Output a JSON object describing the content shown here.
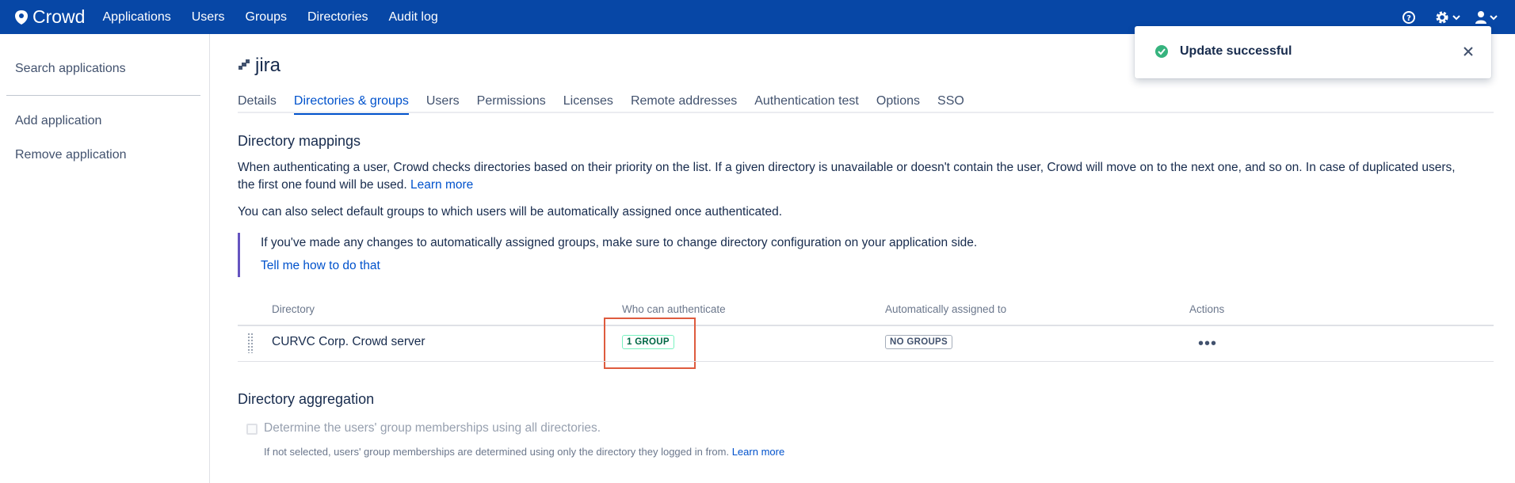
{
  "app": {
    "name": "Crowd"
  },
  "topnav": {
    "items": [
      "Applications",
      "Users",
      "Groups",
      "Directories",
      "Audit log"
    ]
  },
  "topbar_icons": [
    "help-icon",
    "settings-icon",
    "user-icon"
  ],
  "sidebar": {
    "items": [
      "Search applications",
      "Add application",
      "Remove application"
    ]
  },
  "page": {
    "title": "jira"
  },
  "tabs": [
    "Details",
    "Directories & groups",
    "Users",
    "Permissions",
    "Licenses",
    "Remote addresses",
    "Authentication test",
    "Options",
    "SSO"
  ],
  "active_tab": "Directories & groups",
  "mappings": {
    "heading": "Directory mappings",
    "desc1": "When authenticating a user, Crowd checks directories based on their priority on the list. If a given directory is unavailable or doesn't contain the user, Crowd will move on to the next one, and so on. In case of duplicated users,",
    "desc1b": "the first one found will be used.",
    "learn_more": "Learn more",
    "desc2": "You can also select default groups to which users will be automatically assigned once authenticated.",
    "callout_text": "If you've made any changes to automatically assigned groups, make sure to change directory configuration on your application side.",
    "callout_link": "Tell me how to do that"
  },
  "table": {
    "headers": [
      "Directory",
      "Who can authenticate",
      "Automatically assigned to",
      "Actions"
    ],
    "rows": [
      {
        "directory": "CURVC Corp. Crowd server",
        "who": "1 GROUP",
        "assigned": "NO GROUPS",
        "actions": "•••"
      }
    ]
  },
  "aggregation": {
    "heading": "Directory aggregation",
    "checkbox_label": "Determine the users' group memberships using all directories.",
    "checked": false,
    "help": "If not selected, users' group memberships are determined using only the directory they logged in from.",
    "learn_more": "Learn more"
  },
  "toast": {
    "title": "Update successful",
    "status": "success"
  },
  "colors": {
    "topbar": "#0747a6",
    "link": "#0052cc",
    "success": "#36b37e",
    "highlight": "#de5b3e",
    "callout": "#6554c0"
  }
}
